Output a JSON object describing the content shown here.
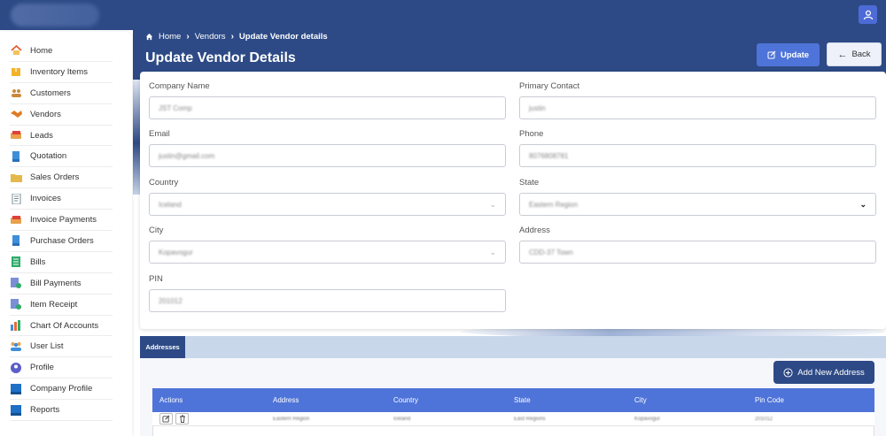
{
  "sidebar": {
    "items": [
      {
        "label": "Home",
        "icon": "home-icon",
        "color": "#e0552b"
      },
      {
        "label": "Inventory Items",
        "icon": "box-icon",
        "color": "#f2b32b"
      },
      {
        "label": "Customers",
        "icon": "customers-icon",
        "color": "#c98a3a"
      },
      {
        "label": "Vendors",
        "icon": "handshake-icon",
        "color": "#e07b24"
      },
      {
        "label": "Leads",
        "icon": "leads-icon",
        "color": "#e9a14c"
      },
      {
        "label": "Quotation",
        "icon": "quotation-icon",
        "color": "#3f8ed9"
      },
      {
        "label": "Sales Orders",
        "icon": "folder-icon",
        "color": "#e4b84a"
      },
      {
        "label": "Invoices",
        "icon": "invoice-icon",
        "color": "#7a8c96"
      },
      {
        "label": "Invoice Payments",
        "icon": "payment-icon",
        "color": "#e9a14c"
      },
      {
        "label": "Purchase Orders",
        "icon": "purchase-icon",
        "color": "#3f8ed9"
      },
      {
        "label": "Bills",
        "icon": "bills-icon",
        "color": "#2eaa6a"
      },
      {
        "label": "Bill Payments",
        "icon": "bill-payment-icon",
        "color": "#7a8fd6"
      },
      {
        "label": "Item Receipt",
        "icon": "receipt-icon",
        "color": "#7a8fd6"
      },
      {
        "label": "Chart Of Accounts",
        "icon": "chart-icon",
        "color": "#e86a3a"
      },
      {
        "label": "User List",
        "icon": "users-icon",
        "color": "#3f8ed9"
      },
      {
        "label": "Profile",
        "icon": "profile-icon",
        "color": "#5b5fc7"
      },
      {
        "label": "Company Profile",
        "icon": "company-icon",
        "color": "#1f6fc7"
      },
      {
        "label": "Reports",
        "icon": "reports-icon",
        "color": "#1f6fc7"
      }
    ]
  },
  "breadcrumb": {
    "home": "Home",
    "vendors": "Vendors",
    "current": "Update Vendor details"
  },
  "page": {
    "title": "Update Vendor Details"
  },
  "buttons": {
    "update": "Update",
    "back": "Back",
    "add_address": "Add New Address"
  },
  "form": {
    "company_name": {
      "label": "Company Name",
      "value": "JST Comp"
    },
    "primary_contact": {
      "label": "Primary Contact",
      "value": "justin"
    },
    "email": {
      "label": "Email",
      "value": "justin@gmail.com"
    },
    "phone": {
      "label": "Phone",
      "value": "8076808781"
    },
    "country": {
      "label": "Country",
      "value": "Iceland"
    },
    "state": {
      "label": "State",
      "value": "Eastern Region"
    },
    "city": {
      "label": "City",
      "value": "Kopavogur"
    },
    "address": {
      "label": "Address",
      "value": "CDD-37 Town"
    },
    "pin": {
      "label": "PIN",
      "value": "201012"
    }
  },
  "addresses": {
    "tab": "Addresses",
    "columns": [
      "Actions",
      "Address",
      "Country",
      "State",
      "City",
      "Pin Code"
    ],
    "rows": [
      {
        "address": "Eastern Region",
        "country": "Iceland",
        "state": "East Regions",
        "city": "Kopavogur",
        "pin": "201012"
      }
    ]
  },
  "colors": {
    "primary": "#2d4a86",
    "accent": "#4f74d9"
  }
}
